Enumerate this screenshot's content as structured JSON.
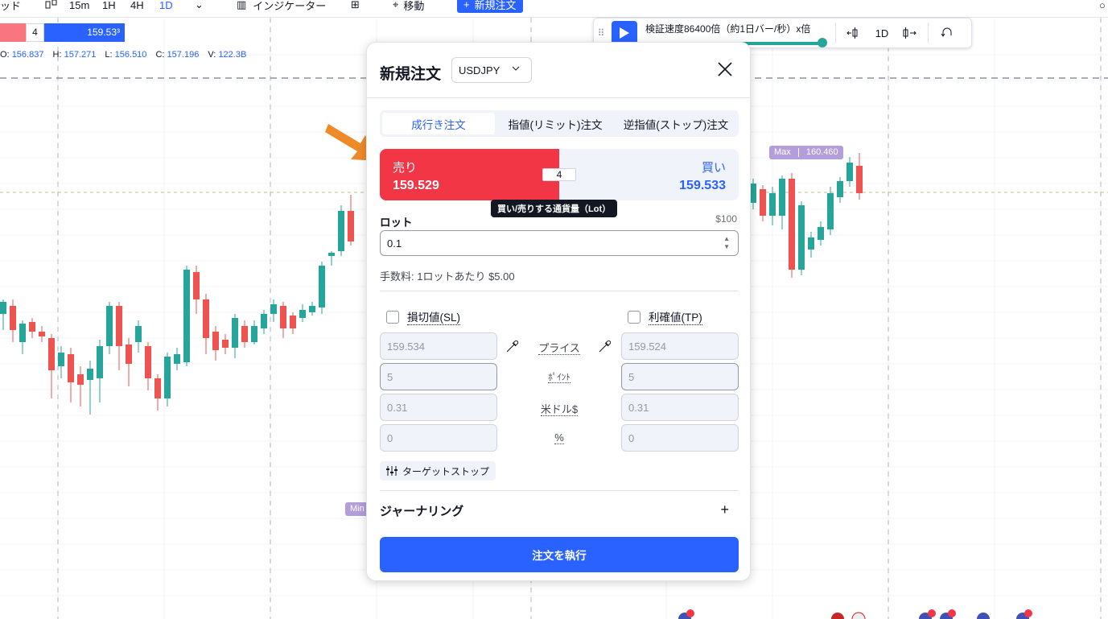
{
  "toolbar": {
    "items": [
      "ッド",
      "15m",
      "1H",
      "4H",
      "1D",
      "インジケーター",
      "移動",
      "新規注文"
    ],
    "active_interval": "1D"
  },
  "price_label": {
    "spread": "4",
    "ask": "159.53³"
  },
  "ohlc": {
    "o_label": "O:",
    "o": "156.837",
    "h_label": "H:",
    "h": "157.271",
    "l_label": "L:",
    "l": "156.510",
    "c_label": "C:",
    "c": "157.196",
    "v_label": "V:",
    "v": "122.3B"
  },
  "replay": {
    "speed_label": "検証速度86400倍（約1日バー/秒）x倍",
    "interval": "1D"
  },
  "badges": {
    "max_label": "Max",
    "max_value": "160.460",
    "min_label": "Min"
  },
  "order_dialog": {
    "title": "新規注文",
    "symbol": "USDJPY",
    "tabs": [
      "成行き注文",
      "指値(リミット)注文",
      "逆指値(ストップ)注文"
    ],
    "active_tab": 0,
    "sell_label": "売り",
    "sell_price": "159.529",
    "buy_label": "買い",
    "buy_price": "159.533",
    "spread": "4",
    "tooltip": "買い/売りする通貨量（Lot）",
    "lot_label": "ロット",
    "lot_unit": "$100",
    "lot_value": "0.1",
    "fee_text": "手数料: 1ロットあたり $5.00",
    "sl_label": "損切値(SL)",
    "tp_label": "利確値(TP)",
    "row_labels": [
      "プライス",
      "ﾎﾟｲﾝﾄ",
      "米ドル$",
      "%"
    ],
    "sl_values": [
      "159.534",
      "5",
      "0.31",
      "0"
    ],
    "tp_values": [
      "159.524",
      "5",
      "0.31",
      "0"
    ],
    "target_stop": "ターゲットストップ",
    "journal": "ジャーナリング",
    "submit": "注文を執行"
  },
  "colors": {
    "up": "#26a69a",
    "down": "#ef5350",
    "accent": "#2962ff",
    "sell": "#f23645"
  },
  "chart_data": {
    "type": "candlestick",
    "visible_values": {
      "max": "160.460"
    },
    "candles_left": [
      {
        "o": 0.51,
        "c": 0.46,
        "h": 0.48,
        "l": 0.55
      },
      {
        "o": 0.52,
        "c": 0.55,
        "h": 0.51,
        "l": 0.58
      },
      {
        "o": 0.53,
        "c": 0.52,
        "h": 0.51,
        "l": 0.56
      }
    ]
  }
}
